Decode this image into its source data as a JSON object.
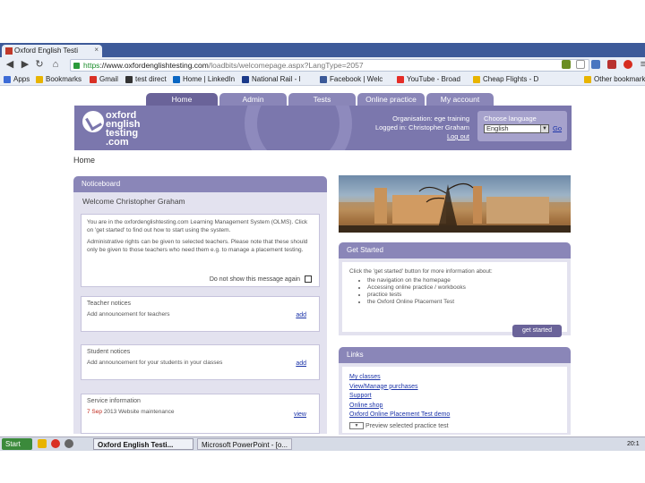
{
  "browser": {
    "tab_title": "Oxford English Testi",
    "tab_close": "×",
    "url_https": "https",
    "url_host": "://www.oxfordenglishtesting.com",
    "url_path": "/loadbits/welcomepage.aspx?LangType=2057",
    "bookmarks": [
      "Apps",
      "Bookmarks",
      "Gmail",
      "test direct",
      "Home | LinkedIn",
      "National Rail - I",
      "Facebook | Welc",
      "YouTube - Broad",
      "Cheap Flights - D",
      "Other bookmarks"
    ]
  },
  "site": {
    "nav": [
      "Home",
      "Admin",
      "Tests",
      "Online practice",
      "My account"
    ],
    "logo": [
      "oxford",
      "english",
      "testing",
      ".com"
    ],
    "org_line": "Organisation: ege training",
    "logged_in": "Logged in: Christopher Graham",
    "logout": "Log out",
    "choose_language": "Choose language",
    "language": "English",
    "go": "Go",
    "breadcrumb": "Home"
  },
  "noticeboard": {
    "title": "Noticeboard",
    "welcome": "Welcome Christopher Graham",
    "intro1": "You are in the oxfordenglishtesting.com Learning Management System (OLMS). Click on 'get started' to find out how to start using the system.",
    "intro2": "Administrative rights can be given to selected teachers. Please note that these should only be given to those teachers who need them e.g. to manage a placement testing.",
    "dont_show": "Do not show this message again",
    "teacher_title": "Teacher notices",
    "teacher_text": "Add announcement for teachers",
    "teacher_add": "add",
    "student_title": "Student notices",
    "student_text": "Add announcement for your students in your classes",
    "student_add": "add",
    "service_title": "Service information",
    "service_date": "7 Sep",
    "service_text": "2013 Website maintenance",
    "service_link": "view"
  },
  "get_started": {
    "title": "Get Started",
    "text": "Click the 'get started' button for more information about:",
    "items": [
      "the navigation on the homepage",
      "Accessing online practice / workbooks",
      "practice tests",
      "the Oxford Online Placement Test"
    ],
    "button": "get started"
  },
  "links": {
    "title": "Links",
    "items": [
      "My classes",
      "View/Manage purchases",
      "Support",
      "Online shop",
      "Oxford Online Placement Test demo"
    ],
    "preview": "Preview selected practice test"
  },
  "taskbar": {
    "start": "Start",
    "items": [
      "Oxford English Testi...",
      "Microsoft PowerPoint - [o..."
    ],
    "clock": "20:1"
  },
  "colors": {
    "brand_purple": "#7b77ad",
    "tab_purple": "#8a86b8",
    "link_blue": "#1b33a8"
  }
}
